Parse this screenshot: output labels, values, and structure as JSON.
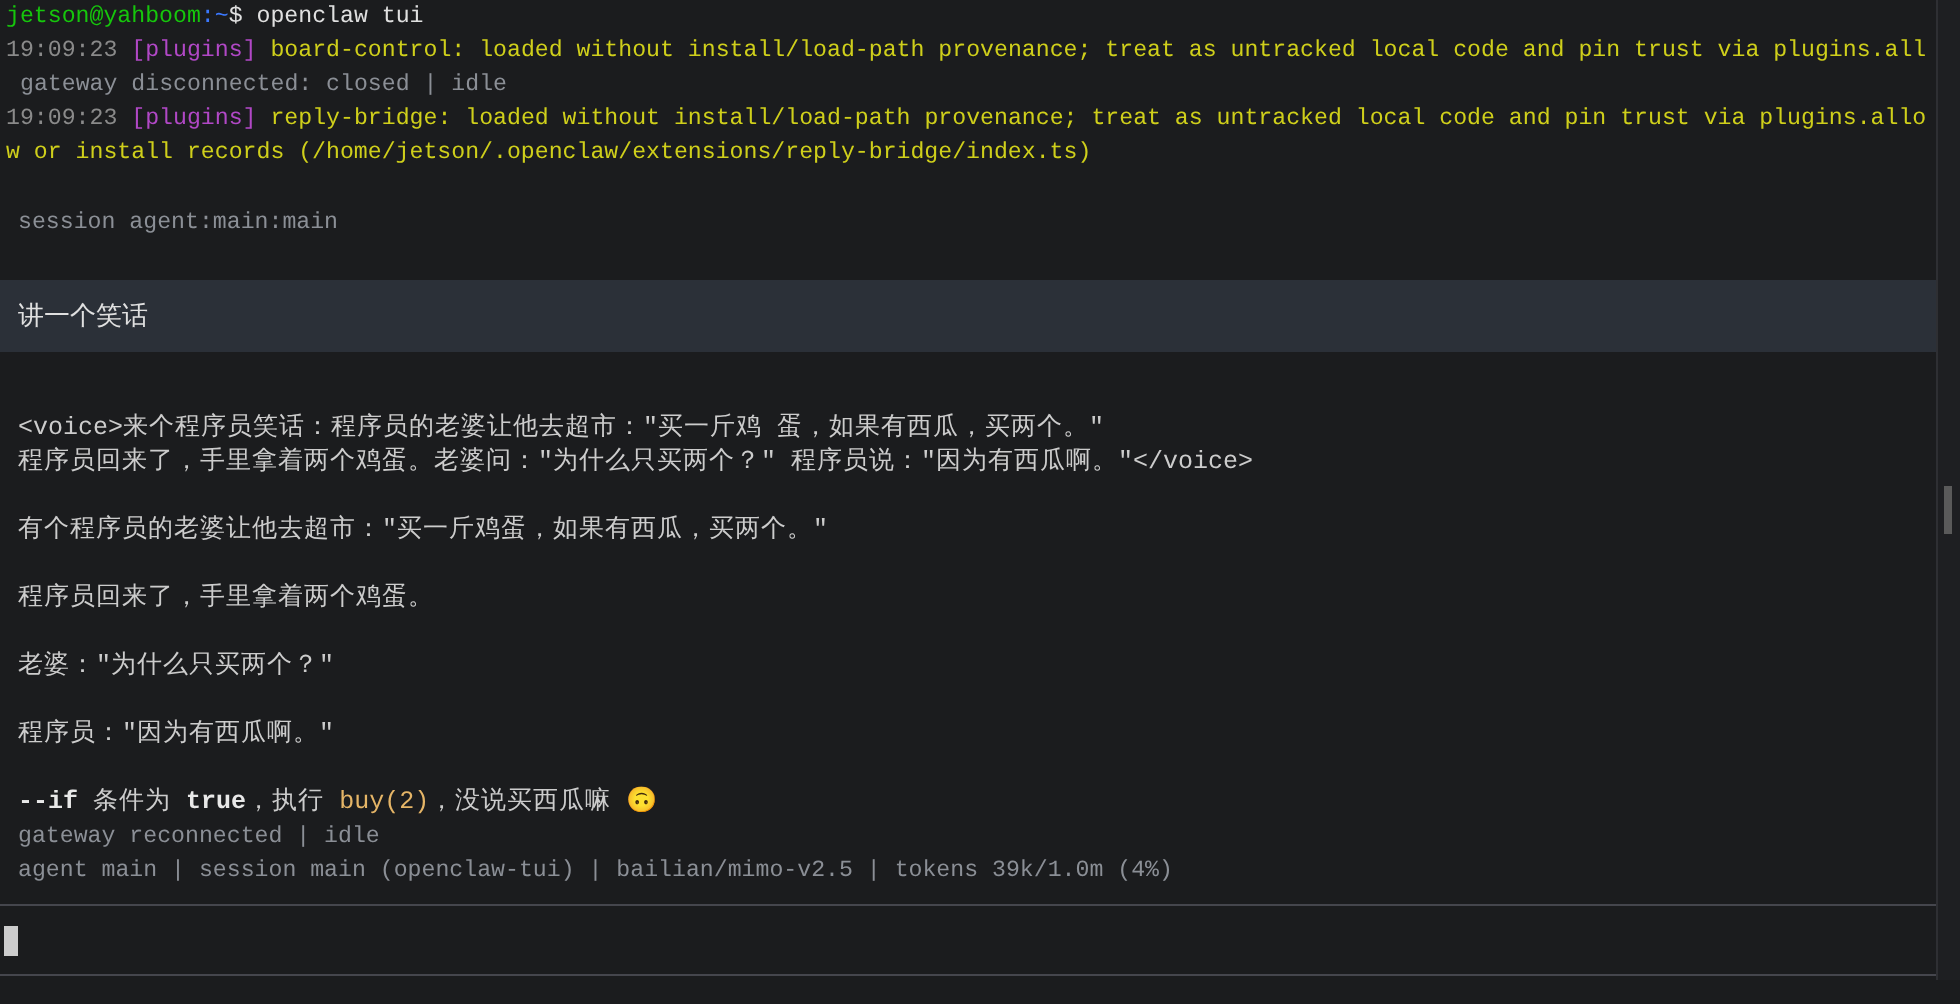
{
  "prompt": {
    "user_host": "jetson@yahboom",
    "path": ":~",
    "symbol": "$",
    "command": "openclaw tui"
  },
  "log": [
    {
      "kind": "plugin",
      "time": "19:09:23",
      "tag": "[plugins]",
      "message": "board-control: loaded without install/load-path provenance; treat as untracked local code and pin trust via plugins.all"
    },
    {
      "kind": "status",
      "text": "gateway disconnected: closed | idle"
    },
    {
      "kind": "plugin",
      "time": "19:09:23",
      "tag": "[plugins]",
      "message": "reply-bridge: loaded without install/load-path provenance; treat as untracked local code and pin trust via plugins.allow or install records (/home/jetson/.openclaw/extensions/reply-bridge/index.ts)"
    }
  ],
  "session_label": "session agent:main:main",
  "user_message": "讲一个笑话",
  "reply": [
    {
      "kind": "lines",
      "lines": [
        "<voice>来个程序员笑话：程序员的老婆让他去超市：\"买一斤鸡 蛋，如果有西瓜，买两个。\"",
        "程序员回来了，手里拿着两个鸡蛋。老婆问：\"为什么只买两个？\" 程序员说：\"因为有西瓜啊。\"</voice>"
      ]
    },
    {
      "kind": "lines",
      "lines": [
        "有个程序员的老婆让他去超市：\"买一斤鸡蛋，如果有西瓜，买两个。\""
      ]
    },
    {
      "kind": "lines",
      "lines": [
        "程序员回来了，手里拿着两个鸡蛋。"
      ]
    },
    {
      "kind": "lines",
      "lines": [
        "老婆：\"为什么只买两个？\""
      ]
    },
    {
      "kind": "lines",
      "lines": [
        "程序员：\"因为有西瓜啊。\""
      ]
    },
    {
      "kind": "segments",
      "segments": [
        {
          "kind": "bold",
          "text": "--if"
        },
        {
          "kind": "plain",
          "text": " 条件为 "
        },
        {
          "kind": "bold",
          "text": "true"
        },
        {
          "kind": "plain",
          "text": "，执行 "
        },
        {
          "kind": "code",
          "text": "buy(2)"
        },
        {
          "kind": "plain",
          "text": "，没说买西瓜嘛 🙃"
        }
      ]
    }
  ],
  "connection_status": "gateway reconnected | idle",
  "footer": "agent main | session main (openclaw-tui) | bailian/mimo-v2.5 | tokens 39k/1.0m (4%)"
}
